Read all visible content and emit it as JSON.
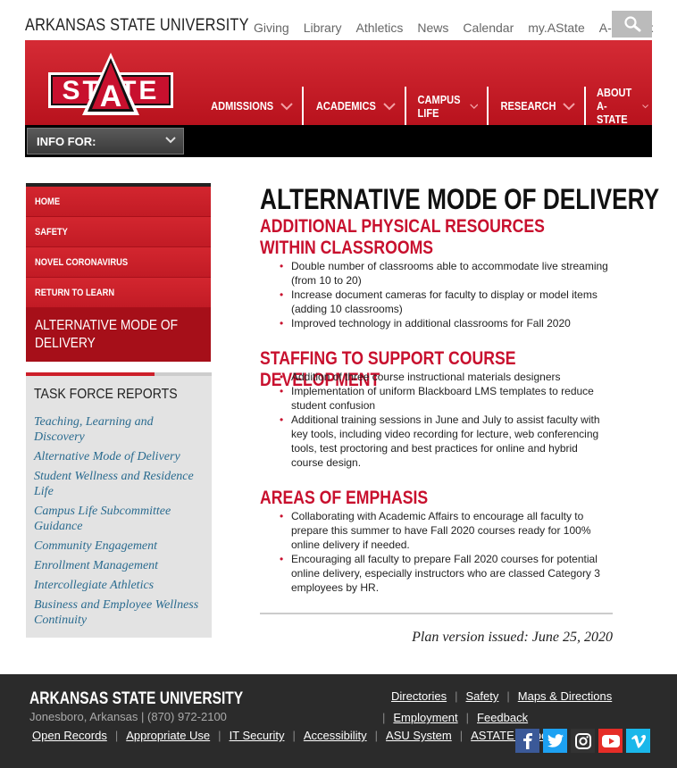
{
  "site": {
    "name": "ARKANSAS STATE UNIVERSITY"
  },
  "utility_nav": [
    "Giving",
    "Library",
    "Athletics",
    "News",
    "Calendar",
    "my.AState",
    "A-Z Index"
  ],
  "logo": {
    "text": "STATE",
    "letter": "A"
  },
  "main_nav": [
    "ADMISSIONS",
    "ACADEMICS",
    "CAMPUS LIFE",
    "RESEARCH",
    "ABOUT A-STATE"
  ],
  "info_for": "INFO FOR:",
  "sidebar": {
    "items": [
      "HOME",
      "SAFETY",
      "NOVEL CORONAVIRUS",
      "RETURN TO LEARN"
    ],
    "active": "ALTERNATIVE MODE OF DELIVERY"
  },
  "task_force": {
    "title": "TASK FORCE REPORTS",
    "links": [
      "Teaching, Learning and Discovery",
      "Alternative Mode of Delivery",
      "Student Wellness and Residence Life",
      "Campus Life Subcommittee Guidance",
      "Community Engagement",
      "Enrollment Management",
      "Intercollegiate Athletics",
      "Business and Employee Wellness Continuity"
    ]
  },
  "main": {
    "title": "ALTERNATIVE MODE OF DELIVERY",
    "sections": [
      {
        "title": "ADDITIONAL PHYSICAL RESOURCES WITHIN CLASSROOMS",
        "bullets": [
          "Double number of classrooms able to accommodate live streaming (from 10 to 20)",
          "Increase document cameras for faculty to display or model items (adding 10 classrooms)",
          "Improved technology in additional classrooms for Fall 2020"
        ]
      },
      {
        "title": "STAFFING TO SUPPORT COURSE DEVELOPMENT",
        "bullets": [
          "Addition of three course instructional materials designers",
          "Implementation of uniform Blackboard LMS templates to reduce student confusion",
          "Additional training sessions in June and July to assist faculty with key tools, including video recording for lecture, web conferencing tools, test proctoring and best practices for online and hybrid course design."
        ]
      },
      {
        "title": "AREAS OF EMPHASIS",
        "bullets": [
          "Collaborating with Academic Affairs to encourage all faculty to prepare this summer to have Fall 2020 courses ready for 100% online delivery if needed.",
          "Encouraging all faculty to prepare Fall 2020 courses for potential online delivery, especially instructors who are classed Category 3 employees by HR."
        ]
      }
    ],
    "plan_version": "Plan version issued: June 25, 2020"
  },
  "footer": {
    "name": "ARKANSAS STATE UNIVERSITY",
    "address": "Jonesboro, Arkansas | (870) 972-2100",
    "links_row1": [
      "Directories",
      "Safety",
      "Maps & Directions"
    ],
    "links_row2": [
      "Employment",
      "Feedback"
    ],
    "links_bottom": [
      "Open Records",
      "Appropriate Use",
      "IT Security",
      "Accessibility",
      "ASU System",
      "ASTATE Helpdesk"
    ],
    "social": [
      "facebook",
      "twitter",
      "instagram",
      "youtube",
      "vimeo"
    ]
  },
  "colors": {
    "brand_red": "#cc1f2a",
    "link_blue": "#2a6b8f",
    "footer_bg": "#2b2b2b"
  }
}
